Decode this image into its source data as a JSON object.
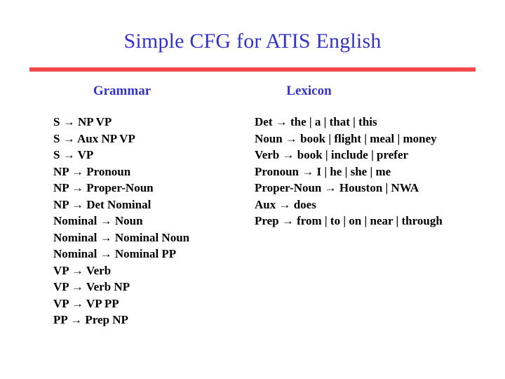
{
  "slide": {
    "title": "Simple CFG for ATIS English",
    "title_color": "#3333CC",
    "rule_color": "#F04A4A",
    "background_color": "#FFFFFF",
    "body_text_color": "#000000"
  },
  "grammar": {
    "header": "Grammar",
    "rules": [
      "S → NP VP",
      "S → Aux NP VP",
      "S → VP",
      "NP → Pronoun",
      "NP → Proper-Noun",
      "NP → Det Nominal",
      "Nominal → Noun",
      "Nominal → Nominal Noun",
      "Nominal → Nominal PP",
      "VP → Verb",
      "VP → Verb NP",
      "VP → VP PP",
      "PP → Prep NP"
    ]
  },
  "lexicon": {
    "header": "Lexicon",
    "rules": [
      "Det → the | a | that | this",
      "Noun → book | flight | meal | money",
      "Verb → book | include | prefer",
      "Pronoun → I | he | she | me",
      "Proper-Noun → Houston | NWA",
      "Aux → does",
      "Prep → from | to | on | near | through"
    ]
  }
}
